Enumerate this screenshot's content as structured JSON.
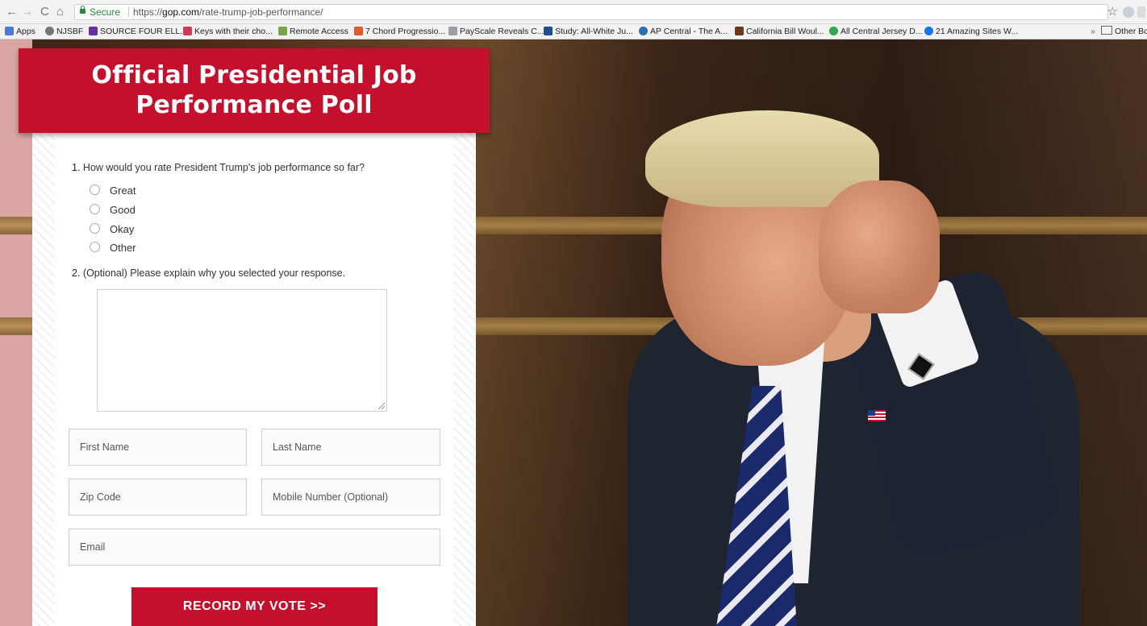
{
  "browser": {
    "nav": {
      "back": "←",
      "forward": "→",
      "reload": "C",
      "home": "⌂"
    },
    "secure_label": "Secure",
    "url_scheme": "https://",
    "url_domain": "gop.com",
    "url_path": "/rate-trump-job-performance/",
    "bookmarks": [
      {
        "label": "Apps",
        "icon_color": "#4a7bd6"
      },
      {
        "label": "NJSBF",
        "icon_color": "#777777"
      },
      {
        "label": "SOURCE FOUR ELL...",
        "icon_color": "#6a2fa0"
      },
      {
        "label": "Keys with their cho...",
        "icon_color": "#d2385a"
      },
      {
        "label": "Remote Access",
        "icon_color": "#7aa34a"
      },
      {
        "label": "7 Chord Progressio...",
        "icon_color": "#e05a2a"
      },
      {
        "label": "PayScale Reveals C...",
        "icon_color": "#9aa0a6"
      },
      {
        "label": "Study: All-White Ju...",
        "icon_color": "#1d4f91"
      },
      {
        "label": "AP Central - The A...",
        "icon_color": "#2a6fb0"
      },
      {
        "label": "California Bill Woul...",
        "icon_color": "#6a3a1a"
      },
      {
        "label": "All Central Jersey D...",
        "icon_color": "#2fa84f"
      },
      {
        "label": "21 Amazing Sites W...",
        "icon_color": "#1a73e8"
      }
    ],
    "overflow_label": "»",
    "other_bookmarks": "Other Bo"
  },
  "banner": {
    "line1": "Official Presidential Job",
    "line2": "Performance Poll"
  },
  "question1": {
    "number": "1.",
    "text": "How would you rate President Trump's job performance so far?",
    "options": [
      "Great",
      "Good",
      "Okay",
      "Other"
    ]
  },
  "question2": {
    "number": "2.",
    "text": "(Optional) Please explain why you selected your response."
  },
  "fields": {
    "first_name": "First Name",
    "last_name": "Last Name",
    "zip": "Zip Code",
    "mobile": "Mobile Number (Optional)",
    "email": "Email"
  },
  "submit_label": "RECORD MY VOTE >>",
  "colors": {
    "brand_red": "#c4102c",
    "secure_green": "#2a8a3c"
  }
}
